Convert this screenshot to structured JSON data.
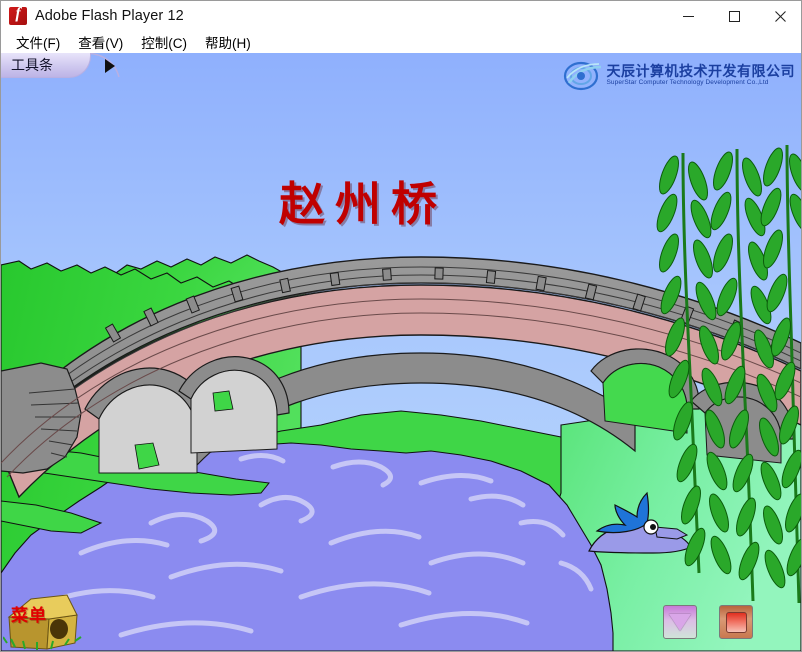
{
  "window": {
    "title": "Adobe Flash Player 12",
    "app_icon": "flash-logo-icon",
    "controls": {
      "minimize": "minimize-icon",
      "maximize": "maximize-icon",
      "close": "close-icon"
    }
  },
  "menubar": {
    "items": [
      {
        "label": "文件(F)"
      },
      {
        "label": "查看(V)"
      },
      {
        "label": "控制(C)"
      },
      {
        "label": "帮助(H)"
      }
    ]
  },
  "toolbar_tab": {
    "label": "工具条",
    "arrow_icon": "triangle-right-icon"
  },
  "branding": {
    "mark_icon": "superstar-swirl-icon",
    "name_cn": "天辰计算机技术开发有限公司",
    "name_en": "SuperStar Computer Technology Development Co.,Ltd"
  },
  "stage": {
    "title": "赵州桥",
    "scene_name": "zhaozhou-bridge-illustration",
    "menu_button": {
      "label": "菜单",
      "icon": "birdhouse-icon"
    },
    "controls": [
      {
        "name": "prev-button",
        "icon": "triangle-down-icon"
      },
      {
        "name": "stop-button",
        "icon": "square-icon"
      }
    ]
  },
  "colors": {
    "sky_top": "#93b4fd",
    "sky_bottom": "#b8d6fd",
    "grass": "#33cc33",
    "grass_light": "#80f0b0",
    "water": "#8b8bf0",
    "water_wave": "#c4c4f5",
    "bridge_stone": "#8c8c8c",
    "bridge_span": "#d6a3a3",
    "title_red": "#c00000",
    "brand_blue": "#1b3fa0",
    "tab_purple": "#cfc8ef"
  }
}
